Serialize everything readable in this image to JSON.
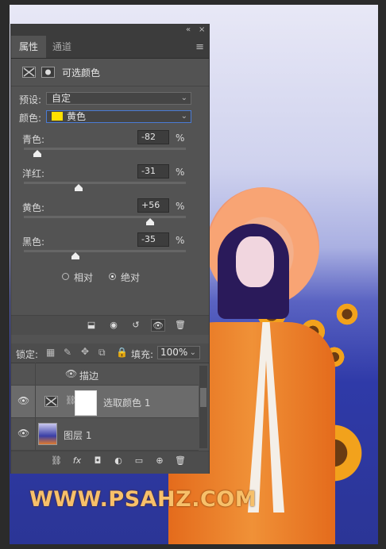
{
  "panel": {
    "header_controls": [
      "«",
      "×"
    ],
    "tabs": [
      {
        "label": "属性",
        "active": true
      },
      {
        "label": "通道",
        "active": false
      }
    ],
    "title": "可选颜色",
    "preset": {
      "label": "预设:",
      "value": "自定"
    },
    "colors": {
      "label": "颜色:",
      "value": "黄色",
      "swatch": "#ffe100"
    },
    "sliders": [
      {
        "label": "青色:",
        "value": "-82",
        "unit": "%",
        "level": -82
      },
      {
        "label": "洋红:",
        "value": "-31",
        "unit": "%",
        "level": -31
      },
      {
        "label": "黄色:",
        "value": "+56",
        "unit": "%",
        "level": 56
      },
      {
        "label": "黑色:",
        "value": "-35",
        "unit": "%",
        "level": -35
      }
    ],
    "method": {
      "relative": "相对",
      "absolute": "绝对",
      "selected": "absolute"
    }
  },
  "layers": {
    "lock_label": "锁定:",
    "fill_label": "填充:",
    "fill_value": "100%",
    "effect_label": "描边",
    "items": [
      {
        "name": "选取颜色 1",
        "selected": true
      },
      {
        "name": "图层 1",
        "selected": false
      }
    ]
  },
  "watermark": "WWW.PSAHZ.COM"
}
